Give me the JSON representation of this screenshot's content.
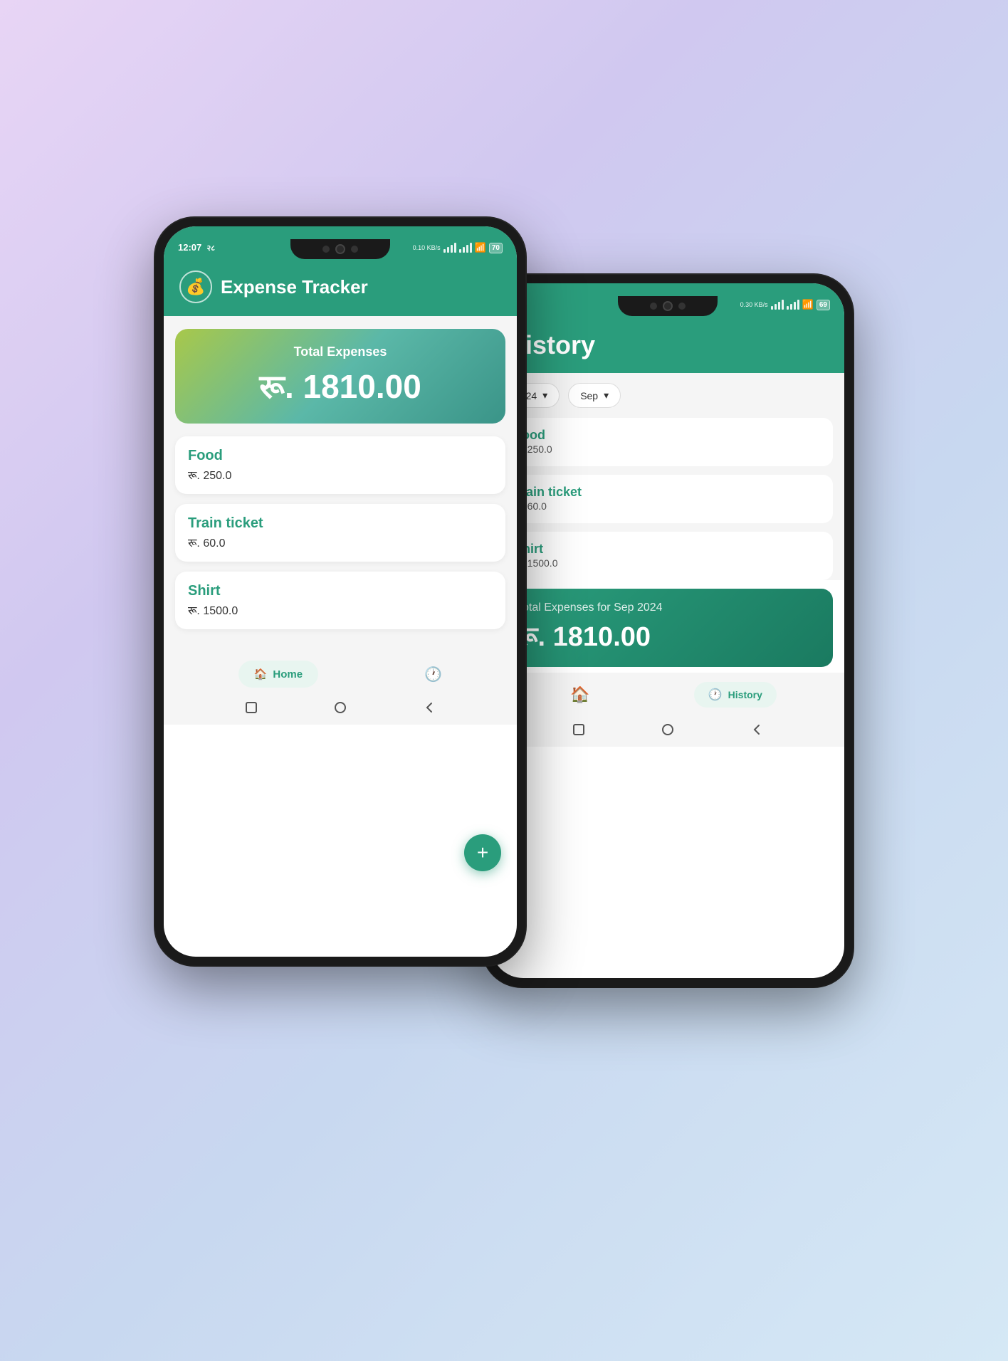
{
  "phone1": {
    "statusBar": {
      "time": "12:07",
      "indicator": "२८",
      "dataSpeed": "0.10 KB/s",
      "battery": "70"
    },
    "header": {
      "logoIcon": "💰",
      "title": "Expense Tracker"
    },
    "totalCard": {
      "label": "Total Expenses",
      "currency": "रू.",
      "amount": "1810.00"
    },
    "expenses": [
      {
        "name": "Food",
        "amount": "रू. 250.0"
      },
      {
        "name": "Train ticket",
        "amount": "रू. 60.0"
      },
      {
        "name": "Shirt",
        "amount": "रू. 1500.0"
      }
    ],
    "nav": {
      "homeLabel": "Home",
      "historyIcon": "🕐"
    },
    "fab": "+"
  },
  "phone2": {
    "statusBar": {
      "dataSpeed": "0.30 KB/s",
      "battery": "69"
    },
    "header": {
      "title": "History"
    },
    "filters": [
      {
        "label": "2024",
        "value": "2024"
      },
      {
        "label": "Sep",
        "value": "Sep"
      }
    ],
    "historyItems": [
      {
        "name": "Food",
        "amount": "रू. 250.0"
      },
      {
        "name": "Train ticket",
        "amount": "रू. 60.0"
      },
      {
        "name": "Shirt",
        "amount": "रू. 1500.0"
      }
    ],
    "totalCard": {
      "label": "Total Expenses for Sep 2024",
      "currency": "रू.",
      "amount": "1810.00"
    },
    "nav": {
      "homeIcon": "🏠",
      "historyLabel": "History"
    }
  }
}
